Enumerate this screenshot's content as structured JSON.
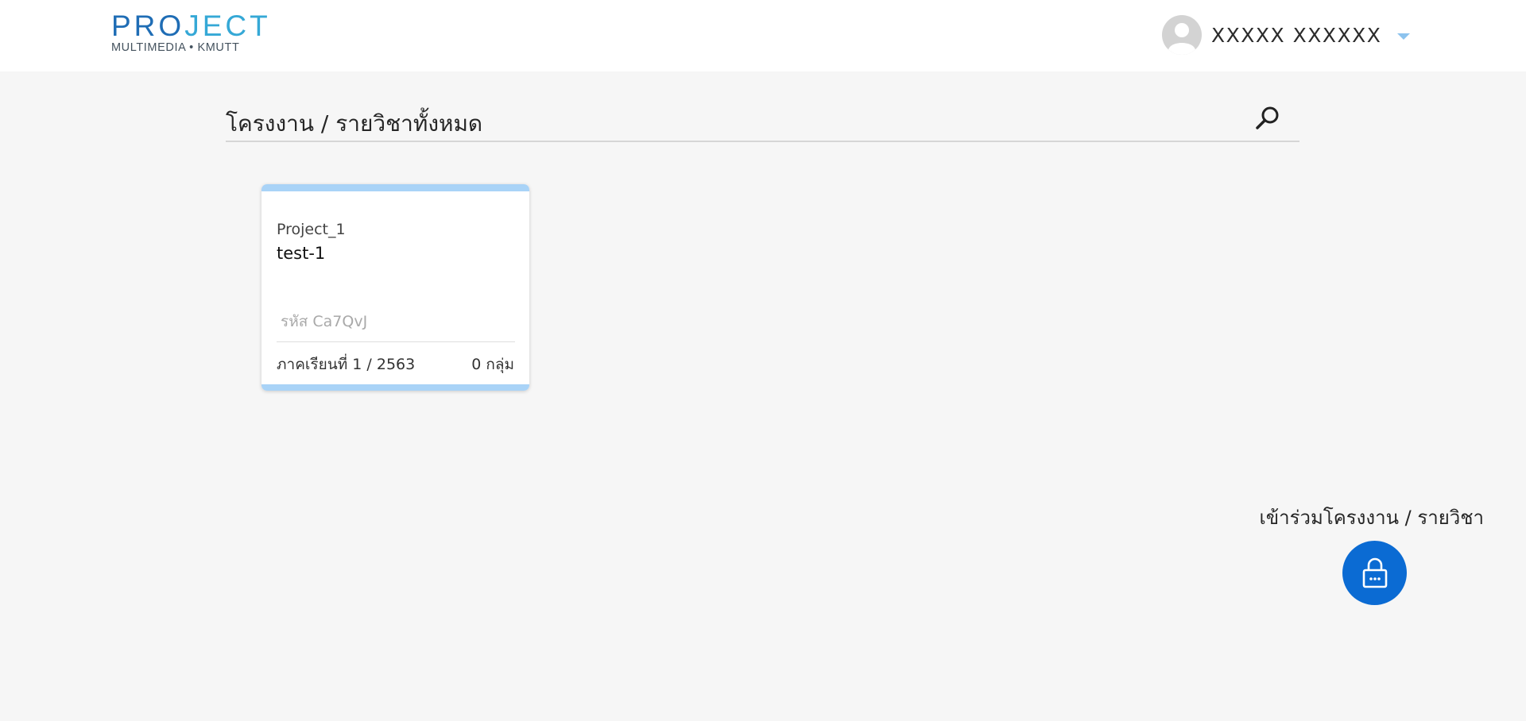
{
  "header": {
    "logo_title_dark": "PRO",
    "logo_title_light": "JECT",
    "logo_subtitle": "MULTIMEDIA • KMUTT",
    "user_name": "XXXXX XXXXXX"
  },
  "breadcrumb": {
    "title": "โครงงาน / รายวิชาทั้งหมด"
  },
  "cards": [
    {
      "code": "Project_1",
      "name": "test-1",
      "key": "รหัส Ca7QvJ",
      "term": "ภาคเรียนที่ 1 / 2563",
      "groups": "0 กลุ่ม"
    }
  ],
  "join": {
    "label": "เข้าร่วมโครงงาน / รายวิชา"
  },
  "colors": {
    "accent": "#0b6bd3",
    "card_strip": "#a9d3f7",
    "logo_blue": "#1f6db5"
  },
  "icons": {
    "search": "search-icon",
    "avatar": "user-avatar-icon",
    "caret": "chevron-down-icon",
    "lock": "lock-icon"
  }
}
